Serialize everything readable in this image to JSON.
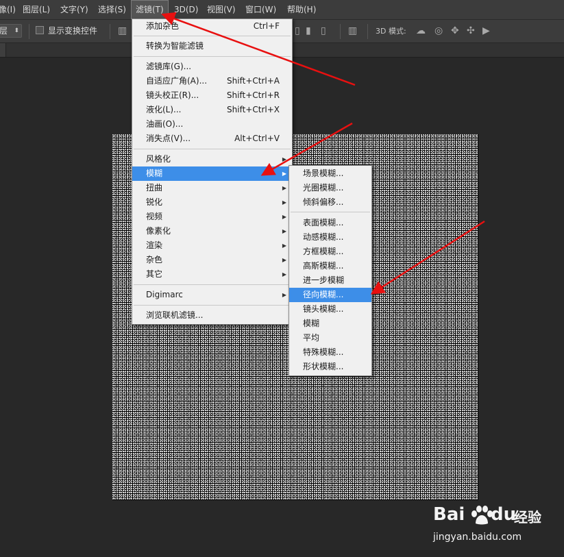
{
  "menubar": {
    "items": [
      {
        "label": "像(I)"
      },
      {
        "label": "图层(L)"
      },
      {
        "label": "文字(Y)"
      },
      {
        "label": "选择(S)"
      },
      {
        "label": "滤镜(T)"
      },
      {
        "label": "3D(D)"
      },
      {
        "label": "视图(V)"
      },
      {
        "label": "窗口(W)"
      },
      {
        "label": "帮助(H)"
      }
    ]
  },
  "options": {
    "select_value": "层",
    "show_transform_label": "显示变换控件",
    "mode_label": "3D 模式:"
  },
  "filter_menu": {
    "items": [
      {
        "label": "添加杂色",
        "shortcut": "Ctrl+F"
      },
      {
        "label": "转换为智能滤镜"
      },
      {
        "label": "滤镜库(G)..."
      },
      {
        "label": "自适应广角(A)...",
        "shortcut": "Shift+Ctrl+A"
      },
      {
        "label": "镜头校正(R)...",
        "shortcut": "Shift+Ctrl+R"
      },
      {
        "label": "液化(L)...",
        "shortcut": "Shift+Ctrl+X"
      },
      {
        "label": "油画(O)..."
      },
      {
        "label": "消失点(V)...",
        "shortcut": "Alt+Ctrl+V"
      },
      {
        "label": "风格化"
      },
      {
        "label": "模糊"
      },
      {
        "label": "扭曲"
      },
      {
        "label": "锐化"
      },
      {
        "label": "视频"
      },
      {
        "label": "像素化"
      },
      {
        "label": "渲染"
      },
      {
        "label": "杂色"
      },
      {
        "label": "其它"
      },
      {
        "label": "Digimarc"
      },
      {
        "label": "浏览联机滤镜..."
      }
    ]
  },
  "blur_menu": {
    "items": [
      {
        "label": "场景模糊..."
      },
      {
        "label": "光圈模糊..."
      },
      {
        "label": "倾斜偏移..."
      },
      {
        "label": "表面模糊..."
      },
      {
        "label": "动感模糊..."
      },
      {
        "label": "方框模糊..."
      },
      {
        "label": "高斯模糊..."
      },
      {
        "label": "进一步模糊"
      },
      {
        "label": "径向模糊..."
      },
      {
        "label": "镜头模糊..."
      },
      {
        "label": "模糊"
      },
      {
        "label": "平均"
      },
      {
        "label": "特殊模糊..."
      },
      {
        "label": "形状模糊..."
      }
    ]
  },
  "watermark": {
    "brand": "Bai",
    "brand_suffix": "du",
    "cn": "经验",
    "url": "jingyan.baidu.com"
  },
  "colors": {
    "highlight": "#3d8ee8",
    "arrow": "#e81010",
    "menu_bg": "#f0f0f0"
  }
}
